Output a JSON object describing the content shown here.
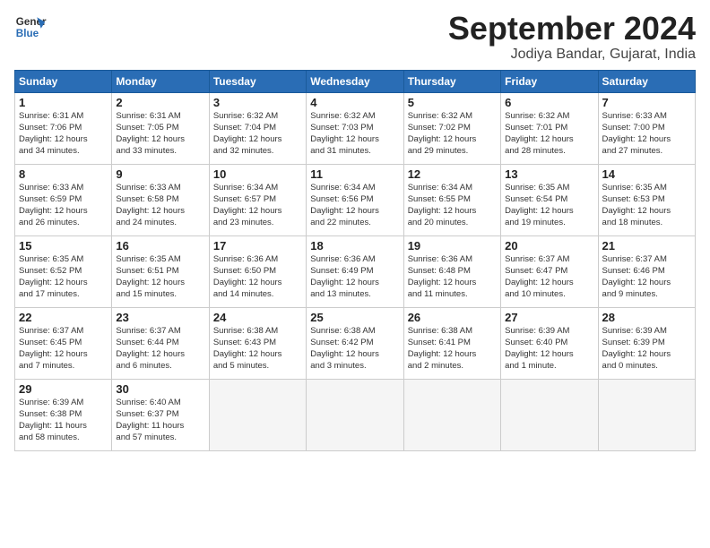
{
  "header": {
    "logo_line1": "General",
    "logo_line2": "Blue",
    "month_title": "September 2024",
    "location": "Jodiya Bandar, Gujarat, India"
  },
  "weekdays": [
    "Sunday",
    "Monday",
    "Tuesday",
    "Wednesday",
    "Thursday",
    "Friday",
    "Saturday"
  ],
  "weeks": [
    [
      {
        "day": "1",
        "sunrise": "6:31 AM",
        "sunset": "7:06 PM",
        "daylight": "12 hours and 34 minutes."
      },
      {
        "day": "2",
        "sunrise": "6:31 AM",
        "sunset": "7:05 PM",
        "daylight": "12 hours and 33 minutes."
      },
      {
        "day": "3",
        "sunrise": "6:32 AM",
        "sunset": "7:04 PM",
        "daylight": "12 hours and 32 minutes."
      },
      {
        "day": "4",
        "sunrise": "6:32 AM",
        "sunset": "7:03 PM",
        "daylight": "12 hours and 31 minutes."
      },
      {
        "day": "5",
        "sunrise": "6:32 AM",
        "sunset": "7:02 PM",
        "daylight": "12 hours and 29 minutes."
      },
      {
        "day": "6",
        "sunrise": "6:32 AM",
        "sunset": "7:01 PM",
        "daylight": "12 hours and 28 minutes."
      },
      {
        "day": "7",
        "sunrise": "6:33 AM",
        "sunset": "7:00 PM",
        "daylight": "12 hours and 27 minutes."
      }
    ],
    [
      {
        "day": "8",
        "sunrise": "6:33 AM",
        "sunset": "6:59 PM",
        "daylight": "12 hours and 26 minutes."
      },
      {
        "day": "9",
        "sunrise": "6:33 AM",
        "sunset": "6:58 PM",
        "daylight": "12 hours and 24 minutes."
      },
      {
        "day": "10",
        "sunrise": "6:34 AM",
        "sunset": "6:57 PM",
        "daylight": "12 hours and 23 minutes."
      },
      {
        "day": "11",
        "sunrise": "6:34 AM",
        "sunset": "6:56 PM",
        "daylight": "12 hours and 22 minutes."
      },
      {
        "day": "12",
        "sunrise": "6:34 AM",
        "sunset": "6:55 PM",
        "daylight": "12 hours and 20 minutes."
      },
      {
        "day": "13",
        "sunrise": "6:35 AM",
        "sunset": "6:54 PM",
        "daylight": "12 hours and 19 minutes."
      },
      {
        "day": "14",
        "sunrise": "6:35 AM",
        "sunset": "6:53 PM",
        "daylight": "12 hours and 18 minutes."
      }
    ],
    [
      {
        "day": "15",
        "sunrise": "6:35 AM",
        "sunset": "6:52 PM",
        "daylight": "12 hours and 17 minutes."
      },
      {
        "day": "16",
        "sunrise": "6:35 AM",
        "sunset": "6:51 PM",
        "daylight": "12 hours and 15 minutes."
      },
      {
        "day": "17",
        "sunrise": "6:36 AM",
        "sunset": "6:50 PM",
        "daylight": "12 hours and 14 minutes."
      },
      {
        "day": "18",
        "sunrise": "6:36 AM",
        "sunset": "6:49 PM",
        "daylight": "12 hours and 13 minutes."
      },
      {
        "day": "19",
        "sunrise": "6:36 AM",
        "sunset": "6:48 PM",
        "daylight": "12 hours and 11 minutes."
      },
      {
        "day": "20",
        "sunrise": "6:37 AM",
        "sunset": "6:47 PM",
        "daylight": "12 hours and 10 minutes."
      },
      {
        "day": "21",
        "sunrise": "6:37 AM",
        "sunset": "6:46 PM",
        "daylight": "12 hours and 9 minutes."
      }
    ],
    [
      {
        "day": "22",
        "sunrise": "6:37 AM",
        "sunset": "6:45 PM",
        "daylight": "12 hours and 7 minutes."
      },
      {
        "day": "23",
        "sunrise": "6:37 AM",
        "sunset": "6:44 PM",
        "daylight": "12 hours and 6 minutes."
      },
      {
        "day": "24",
        "sunrise": "6:38 AM",
        "sunset": "6:43 PM",
        "daylight": "12 hours and 5 minutes."
      },
      {
        "day": "25",
        "sunrise": "6:38 AM",
        "sunset": "6:42 PM",
        "daylight": "12 hours and 3 minutes."
      },
      {
        "day": "26",
        "sunrise": "6:38 AM",
        "sunset": "6:41 PM",
        "daylight": "12 hours and 2 minutes."
      },
      {
        "day": "27",
        "sunrise": "6:39 AM",
        "sunset": "6:40 PM",
        "daylight": "12 hours and 1 minute."
      },
      {
        "day": "28",
        "sunrise": "6:39 AM",
        "sunset": "6:39 PM",
        "daylight": "12 hours and 0 minutes."
      }
    ],
    [
      {
        "day": "29",
        "sunrise": "6:39 AM",
        "sunset": "6:38 PM",
        "daylight": "11 hours and 58 minutes."
      },
      {
        "day": "30",
        "sunrise": "6:40 AM",
        "sunset": "6:37 PM",
        "daylight": "11 hours and 57 minutes."
      },
      null,
      null,
      null,
      null,
      null
    ]
  ]
}
